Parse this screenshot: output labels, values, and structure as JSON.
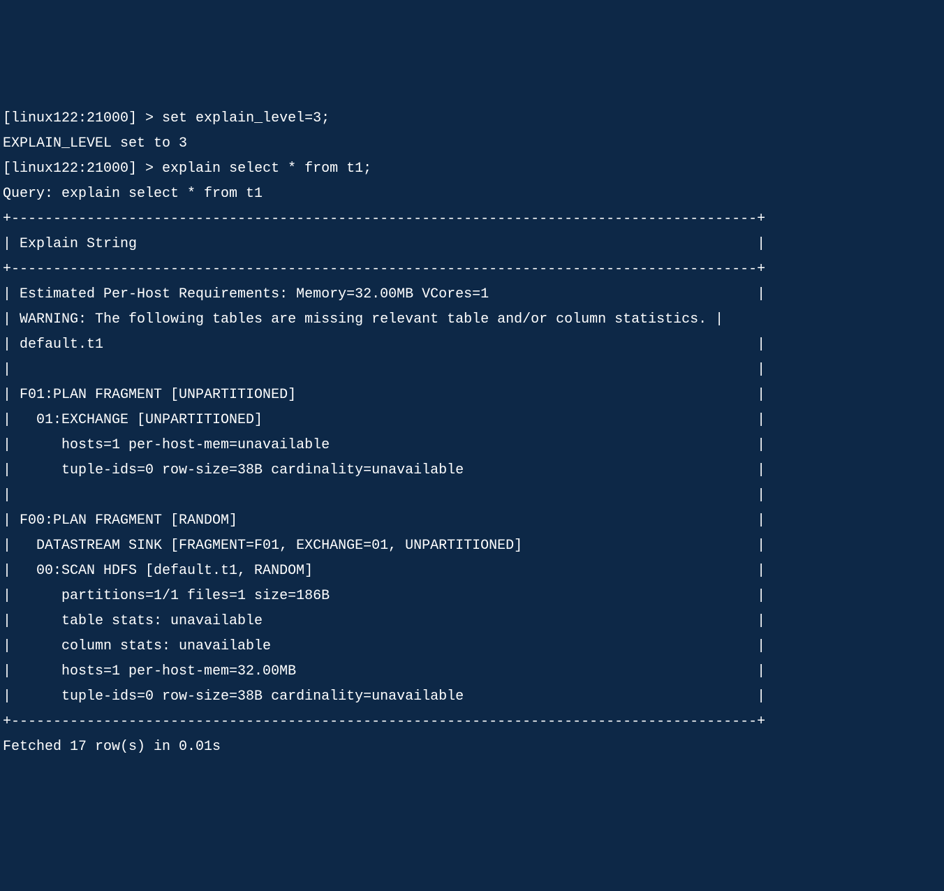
{
  "terminal": {
    "prompt1": "[linux122:21000] > ",
    "command1": "set explain_level=3;",
    "response1": "EXPLAIN_LEVEL set to 3",
    "prompt2": "[linux122:21000] > ",
    "command2": "explain select * from t1;",
    "response2": "Query: explain select * from t1",
    "table_border": "+-----------------------------------------------------------------------------------------+",
    "header_line": "| Explain String                                                                          |",
    "row1": "| Estimated Per-Host Requirements: Memory=32.00MB VCores=1                                |",
    "row2": "| WARNING: The following tables are missing relevant table and/or column statistics. |",
    "row3": "| default.t1                                                                              |",
    "row4": "|                                                                                         |",
    "row5": "| F01:PLAN FRAGMENT [UNPARTITIONED]                                                       |",
    "row6": "|   01:EXCHANGE [UNPARTITIONED]                                                           |",
    "row7": "|      hosts=1 per-host-mem=unavailable                                                   |",
    "row8": "|      tuple-ids=0 row-size=38B cardinality=unavailable                                   |",
    "row9": "|                                                                                         |",
    "row10": "| F00:PLAN FRAGMENT [RANDOM]                                                              |",
    "row11": "|   DATASTREAM SINK [FRAGMENT=F01, EXCHANGE=01, UNPARTITIONED]                            |",
    "row12": "|   00:SCAN HDFS [default.t1, RANDOM]                                                     |",
    "row13": "|      partitions=1/1 files=1 size=186B                                                   |",
    "row14": "|      table stats: unavailable                                                           |",
    "row15": "|      column stats: unavailable                                                          |",
    "row16": "|      hosts=1 per-host-mem=32.00MB                                                       |",
    "row17": "|      tuple-ids=0 row-size=38B cardinality=unavailable                                   |",
    "footer": "Fetched 17 row(s) in 0.01s"
  }
}
